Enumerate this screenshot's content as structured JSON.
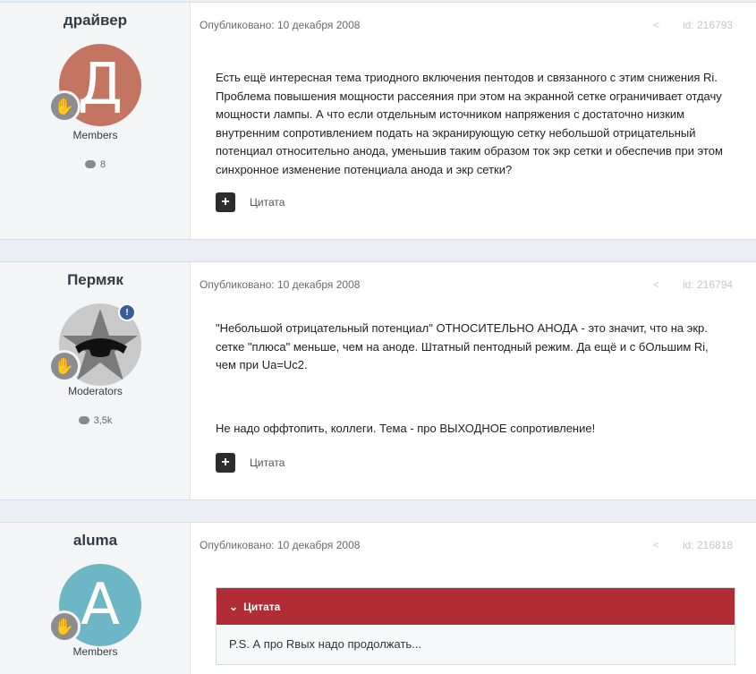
{
  "posts": [
    {
      "author": "драйвер",
      "avatar_letter": "Д",
      "avatar_color": "#c47561",
      "group": "Members",
      "post_count": "8",
      "published": "Опубликовано: 10 декабря 2008",
      "post_id": "id: 216793",
      "content": "Есть ещё интересная тема триодного включения пентодов и связанного с этим снижения Ri. Проблема повышения мощности рассеяния при этом на экранной сетке ограничивает отдачу мощности лампы. А что если отдельным источником напряжения с достаточно низким внутренним сопротивлением подать на экранирующую сетку небольшой отрицательный потенциал относительно анода, уменьшив таким образом ток экр сетки и обеспечив при этом синхронное изменение потенциала анода и экр сетки?",
      "quote_label": "Цитата"
    },
    {
      "author": "Пермяк",
      "group": "Moderators",
      "post_count": "3,5k",
      "published": "Опубликовано: 10 декабря 2008",
      "post_id": "id: 216794",
      "content_line1": "\"Небольшой отрицательный потенциал\" ОТНОСИТЕЛЬНО АНОДА - это значит, что на экр. сетке \"плюса\" меньше, чем на аноде. Штатный пентодный режим. Да ещё и с бОльшим Ri, чем при Ua=Uc2.",
      "content_line2": "Не надо оффтопить, коллеги. Тема - про ВЫХОДНОЕ сопротивление!",
      "quote_label": "Цитата"
    },
    {
      "author": "aluma",
      "avatar_letter": "A",
      "avatar_color": "#6cb6c5",
      "group": "Members",
      "published": "Опубликовано: 10 декабря 2008",
      "post_id": "id: 216818",
      "quote_header": "Цитата",
      "quote_text": "P.S. А про Rвых надо продолжать..."
    }
  ],
  "icons": {
    "share": "share-icon",
    "rank": "hand-badge-icon",
    "comment": "comment-bubble-icon",
    "plus": "plus-icon",
    "chevron": "chevron-down-icon",
    "moderator": "shield-icon"
  },
  "colors": {
    "quote_header": "#b12d36",
    "button_dark": "#2d2d2d"
  }
}
